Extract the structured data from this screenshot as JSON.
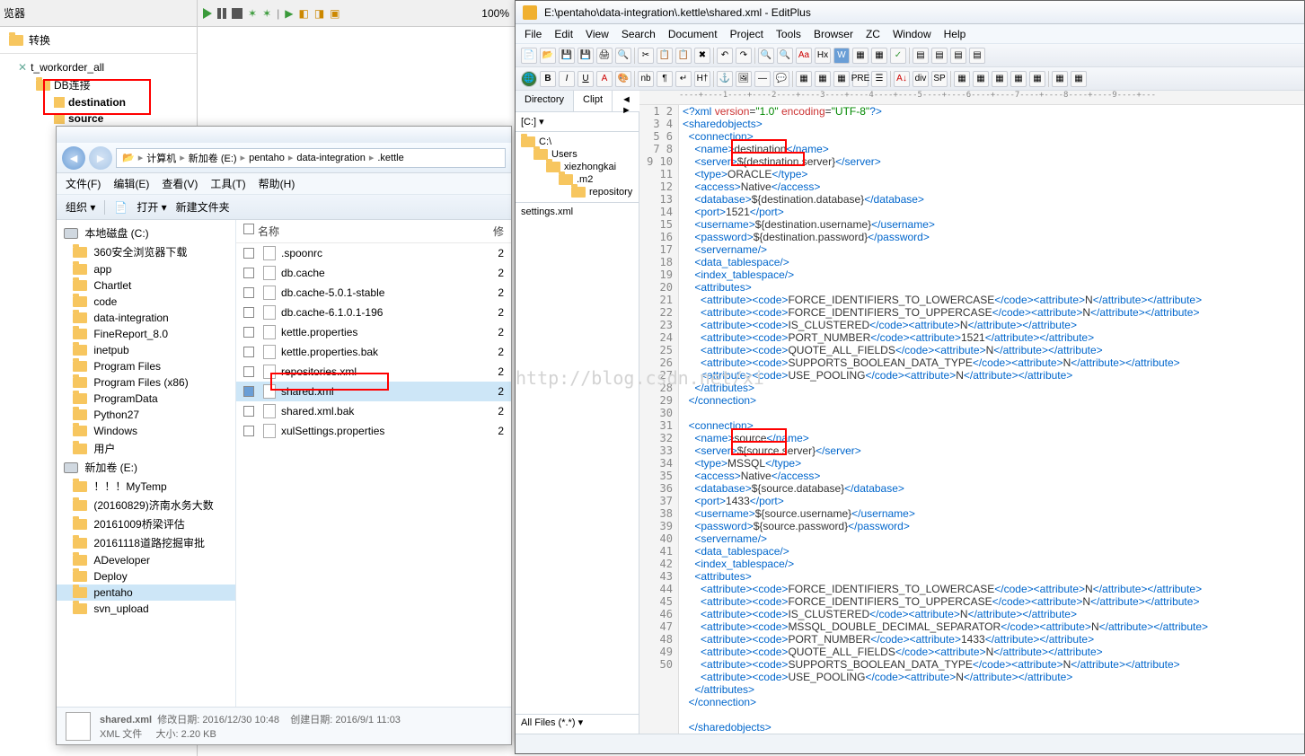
{
  "kettle": {
    "panel_title": "览器",
    "root": "转换",
    "workorder": "t_workorder_all",
    "db_conn": "DB连接",
    "conn_dest": "destination",
    "conn_src": "source"
  },
  "main_toolbar": {
    "zoom": "100%"
  },
  "explorer": {
    "breadcrumb": [
      "计算机",
      "新加卷 (E:)",
      "pentaho",
      "data-integration",
      ".kettle"
    ],
    "menu": [
      "文件(F)",
      "编辑(E)",
      "查看(V)",
      "工具(T)",
      "帮助(H)"
    ],
    "toolbar": {
      "org": "组织 ▾",
      "open": "打开 ▾",
      "newf": "新建文件夹"
    },
    "side_header_c": "本地磁盘 (C:)",
    "side_c": [
      "360安全浏览器下载",
      "app",
      "Chartlet",
      "code",
      "data-integration",
      "FineReport_8.0",
      "inetpub",
      "Program Files",
      "Program Files (x86)",
      "ProgramData",
      "Python27",
      "Windows",
      "用户"
    ],
    "side_header_e": "新加卷 (E:)",
    "side_e": [
      "！！！MyTemp",
      "(20160829)济南水务大数",
      "20161009桥梁评估",
      "20161118道路挖掘审批",
      "ADeveloper",
      "Deploy",
      "pentaho",
      "svn_upload"
    ],
    "col_name": "名称",
    "col_mod": "修",
    "files": [
      ".spoonrc",
      "db.cache",
      "db.cache-5.0.1-stable",
      "db.cache-6.1.0.1-196",
      "kettle.properties",
      "kettle.properties.bak",
      "repositories.xml",
      "shared.xml",
      "shared.xml.bak",
      "xulSettings.properties"
    ],
    "selected_file": "shared.xml",
    "status_name": "shared.xml",
    "status_mod_label": "修改日期:",
    "status_mod": "2016/12/30 10:48",
    "status_create_label": "创建日期:",
    "status_create": "2016/9/1 11:03",
    "status_type": "XML 文件",
    "status_size_label": "大小:",
    "status_size": "2.20 KB"
  },
  "editplus": {
    "title": "E:\\pentaho\\data-integration\\.kettle\\shared.xml - EditPlus",
    "menu": [
      "File",
      "Edit",
      "View",
      "Search",
      "Document",
      "Project",
      "Tools",
      "Browser",
      "ZC",
      "Window",
      "Help"
    ],
    "side_tabs": [
      "Directory",
      "Clipt"
    ],
    "drive": "[C:]",
    "dirs": [
      "C:\\",
      "Users",
      "xiezhongkai",
      ".m2",
      "repository"
    ],
    "filelist": [
      "settings.xml"
    ],
    "filter": "All Files (*.*)",
    "ruler": "----+----1----+----2----+----3----+----4----+----5----+----6----+----7----+----8----+----9----+---",
    "code_lines": [
      {
        "n": 1,
        "h": "<span class='xml-t'>&lt;?xml</span> <span class='xml-a'>version</span>=<span class='xml-v'>\"1.0\"</span> <span class='xml-a'>encoding</span>=<span class='xml-v'>\"UTF-8\"</span><span class='xml-t'>?&gt;</span>"
      },
      {
        "n": 2,
        "h": "<span class='xml-t'>&lt;sharedobjects&gt;</span>"
      },
      {
        "n": 3,
        "h": "  <span class='xml-t'>&lt;connection&gt;</span>"
      },
      {
        "n": 4,
        "h": "    <span class='xml-t'>&lt;name&gt;</span>destination<span class='xml-t'>&lt;/name&gt;</span>"
      },
      {
        "n": 5,
        "h": "    <span class='xml-t'>&lt;server&gt;</span>${destination.server}<span class='xml-t'>&lt;/server&gt;</span>"
      },
      {
        "n": 6,
        "h": "    <span class='xml-t'>&lt;type&gt;</span>ORACLE<span class='xml-t'>&lt;/type&gt;</span>"
      },
      {
        "n": 7,
        "h": "    <span class='xml-t'>&lt;access&gt;</span>Native<span class='xml-t'>&lt;/access&gt;</span>"
      },
      {
        "n": 8,
        "h": "    <span class='xml-t'>&lt;database&gt;</span>${destination.database}<span class='xml-t'>&lt;/database&gt;</span>"
      },
      {
        "n": 9,
        "h": "    <span class='xml-t'>&lt;port&gt;</span>1521<span class='xml-t'>&lt;/port&gt;</span>"
      },
      {
        "n": 10,
        "h": "    <span class='xml-t'>&lt;username&gt;</span>${destination.username}<span class='xml-t'>&lt;/username&gt;</span>"
      },
      {
        "n": 11,
        "h": "    <span class='xml-t'>&lt;password&gt;</span>${destination.password}<span class='xml-t'>&lt;/password&gt;</span>"
      },
      {
        "n": 12,
        "h": "    <span class='xml-t'>&lt;servername/&gt;</span>"
      },
      {
        "n": 13,
        "h": "    <span class='xml-t'>&lt;data_tablespace/&gt;</span>"
      },
      {
        "n": 14,
        "h": "    <span class='xml-t'>&lt;index_tablespace/&gt;</span>"
      },
      {
        "n": 15,
        "h": "    <span class='xml-t'>&lt;attributes&gt;</span>"
      },
      {
        "n": 16,
        "h": "      <span class='xml-t'>&lt;attribute&gt;&lt;code&gt;</span>FORCE_IDENTIFIERS_TO_LOWERCASE<span class='xml-t'>&lt;/code&gt;&lt;attribute&gt;</span>N<span class='xml-t'>&lt;/attribute&gt;&lt;/attribute&gt;</span>"
      },
      {
        "n": 17,
        "h": "      <span class='xml-t'>&lt;attribute&gt;&lt;code&gt;</span>FORCE_IDENTIFIERS_TO_UPPERCASE<span class='xml-t'>&lt;/code&gt;&lt;attribute&gt;</span>N<span class='xml-t'>&lt;/attribute&gt;&lt;/attribute&gt;</span>"
      },
      {
        "n": 18,
        "h": "      <span class='xml-t'>&lt;attribute&gt;&lt;code&gt;</span>IS_CLUSTERED<span class='xml-t'>&lt;/code&gt;&lt;attribute&gt;</span>N<span class='xml-t'>&lt;/attribute&gt;&lt;/attribute&gt;</span>"
      },
      {
        "n": 19,
        "h": "      <span class='xml-t'>&lt;attribute&gt;&lt;code&gt;</span>PORT_NUMBER<span class='xml-t'>&lt;/code&gt;&lt;attribute&gt;</span>1521<span class='xml-t'>&lt;/attribute&gt;&lt;/attribute&gt;</span>"
      },
      {
        "n": 20,
        "h": "      <span class='xml-t'>&lt;attribute&gt;&lt;code&gt;</span>QUOTE_ALL_FIELDS<span class='xml-t'>&lt;/code&gt;&lt;attribute&gt;</span>N<span class='xml-t'>&lt;/attribute&gt;&lt;/attribute&gt;</span>"
      },
      {
        "n": 21,
        "h": "      <span class='xml-t'>&lt;attribute&gt;&lt;code&gt;</span>SUPPORTS_BOOLEAN_DATA_TYPE<span class='xml-t'>&lt;/code&gt;&lt;attribute&gt;</span>N<span class='xml-t'>&lt;/attribute&gt;&lt;/attribute&gt;</span>"
      },
      {
        "n": 22,
        "h": "      <span class='xml-t'>&lt;attribute&gt;&lt;code&gt;</span>USE_POOLING<span class='xml-t'>&lt;/code&gt;&lt;attribute&gt;</span>N<span class='xml-t'>&lt;/attribute&gt;&lt;/attribute&gt;</span>"
      },
      {
        "n": 23,
        "h": "    <span class='xml-t'>&lt;/attributes&gt;</span>"
      },
      {
        "n": 24,
        "h": "  <span class='xml-t'>&lt;/connection&gt;</span>"
      },
      {
        "n": 25,
        "h": ""
      },
      {
        "n": 26,
        "h": "  <span class='xml-t'>&lt;connection&gt;</span>"
      },
      {
        "n": 27,
        "h": "    <span class='xml-t'>&lt;name&gt;</span>source<span class='xml-t'>&lt;/name&gt;</span>"
      },
      {
        "n": 28,
        "h": "    <span class='xml-t'>&lt;server&gt;</span>${source.server}<span class='xml-t'>&lt;/server&gt;</span>"
      },
      {
        "n": 29,
        "h": "    <span class='xml-t'>&lt;type&gt;</span>MSSQL<span class='xml-t'>&lt;/type&gt;</span>"
      },
      {
        "n": 30,
        "h": "    <span class='xml-t'>&lt;access&gt;</span>Native<span class='xml-t'>&lt;/access&gt;</span>"
      },
      {
        "n": 31,
        "h": "    <span class='xml-t'>&lt;database&gt;</span>${source.database}<span class='xml-t'>&lt;/database&gt;</span>"
      },
      {
        "n": 32,
        "h": "    <span class='xml-t'>&lt;port&gt;</span>1433<span class='xml-t'>&lt;/port&gt;</span>"
      },
      {
        "n": 33,
        "h": "    <span class='xml-t'>&lt;username&gt;</span>${source.username}<span class='xml-t'>&lt;/username&gt;</span>"
      },
      {
        "n": 34,
        "h": "    <span class='xml-t'>&lt;password&gt;</span>${source.password}<span class='xml-t'>&lt;/password&gt;</span>"
      },
      {
        "n": 35,
        "h": "    <span class='xml-t'>&lt;servername/&gt;</span>"
      },
      {
        "n": 36,
        "h": "    <span class='xml-t'>&lt;data_tablespace/&gt;</span>"
      },
      {
        "n": 37,
        "h": "    <span class='xml-t'>&lt;index_tablespace/&gt;</span>"
      },
      {
        "n": 38,
        "h": "    <span class='xml-t'>&lt;attributes&gt;</span>"
      },
      {
        "n": 39,
        "h": "      <span class='xml-t'>&lt;attribute&gt;&lt;code&gt;</span>FORCE_IDENTIFIERS_TO_LOWERCASE<span class='xml-t'>&lt;/code&gt;&lt;attribute&gt;</span>N<span class='xml-t'>&lt;/attribute&gt;&lt;/attribute&gt;</span>"
      },
      {
        "n": 40,
        "h": "      <span class='xml-t'>&lt;attribute&gt;&lt;code&gt;</span>FORCE_IDENTIFIERS_TO_UPPERCASE<span class='xml-t'>&lt;/code&gt;&lt;attribute&gt;</span>N<span class='xml-t'>&lt;/attribute&gt;&lt;/attribute&gt;</span>"
      },
      {
        "n": 41,
        "h": "      <span class='xml-t'>&lt;attribute&gt;&lt;code&gt;</span>IS_CLUSTERED<span class='xml-t'>&lt;/code&gt;&lt;attribute&gt;</span>N<span class='xml-t'>&lt;/attribute&gt;&lt;/attribute&gt;</span>"
      },
      {
        "n": 42,
        "h": "      <span class='xml-t'>&lt;attribute&gt;&lt;code&gt;</span>MSSQL_DOUBLE_DECIMAL_SEPARATOR<span class='xml-t'>&lt;/code&gt;&lt;attribute&gt;</span>N<span class='xml-t'>&lt;/attribute&gt;&lt;/attribute&gt;</span>"
      },
      {
        "n": 43,
        "h": "      <span class='xml-t'>&lt;attribute&gt;&lt;code&gt;</span>PORT_NUMBER<span class='xml-t'>&lt;/code&gt;&lt;attribute&gt;</span>1433<span class='xml-t'>&lt;/attribute&gt;&lt;/attribute&gt;</span>"
      },
      {
        "n": 44,
        "h": "      <span class='xml-t'>&lt;attribute&gt;&lt;code&gt;</span>QUOTE_ALL_FIELDS<span class='xml-t'>&lt;/code&gt;&lt;attribute&gt;</span>N<span class='xml-t'>&lt;/attribute&gt;&lt;/attribute&gt;</span>"
      },
      {
        "n": 45,
        "h": "      <span class='xml-t'>&lt;attribute&gt;&lt;code&gt;</span>SUPPORTS_BOOLEAN_DATA_TYPE<span class='xml-t'>&lt;/code&gt;&lt;attribute&gt;</span>N<span class='xml-t'>&lt;/attribute&gt;&lt;/attribute&gt;</span>"
      },
      {
        "n": 46,
        "h": "      <span class='xml-t'>&lt;attribute&gt;&lt;code&gt;</span>USE_POOLING<span class='xml-t'>&lt;/code&gt;&lt;attribute&gt;</span>N<span class='xml-t'>&lt;/attribute&gt;&lt;/attribute&gt;</span>"
      },
      {
        "n": 47,
        "h": "    <span class='xml-t'>&lt;/attributes&gt;</span>"
      },
      {
        "n": 48,
        "h": "  <span class='xml-t'>&lt;/connection&gt;</span>"
      },
      {
        "n": 49,
        "h": ""
      },
      {
        "n": 50,
        "h": "  <span class='xml-t'>&lt;/sharedobjects&gt;</span>"
      }
    ]
  },
  "watermark": "http://blog.csdn.net/xi"
}
